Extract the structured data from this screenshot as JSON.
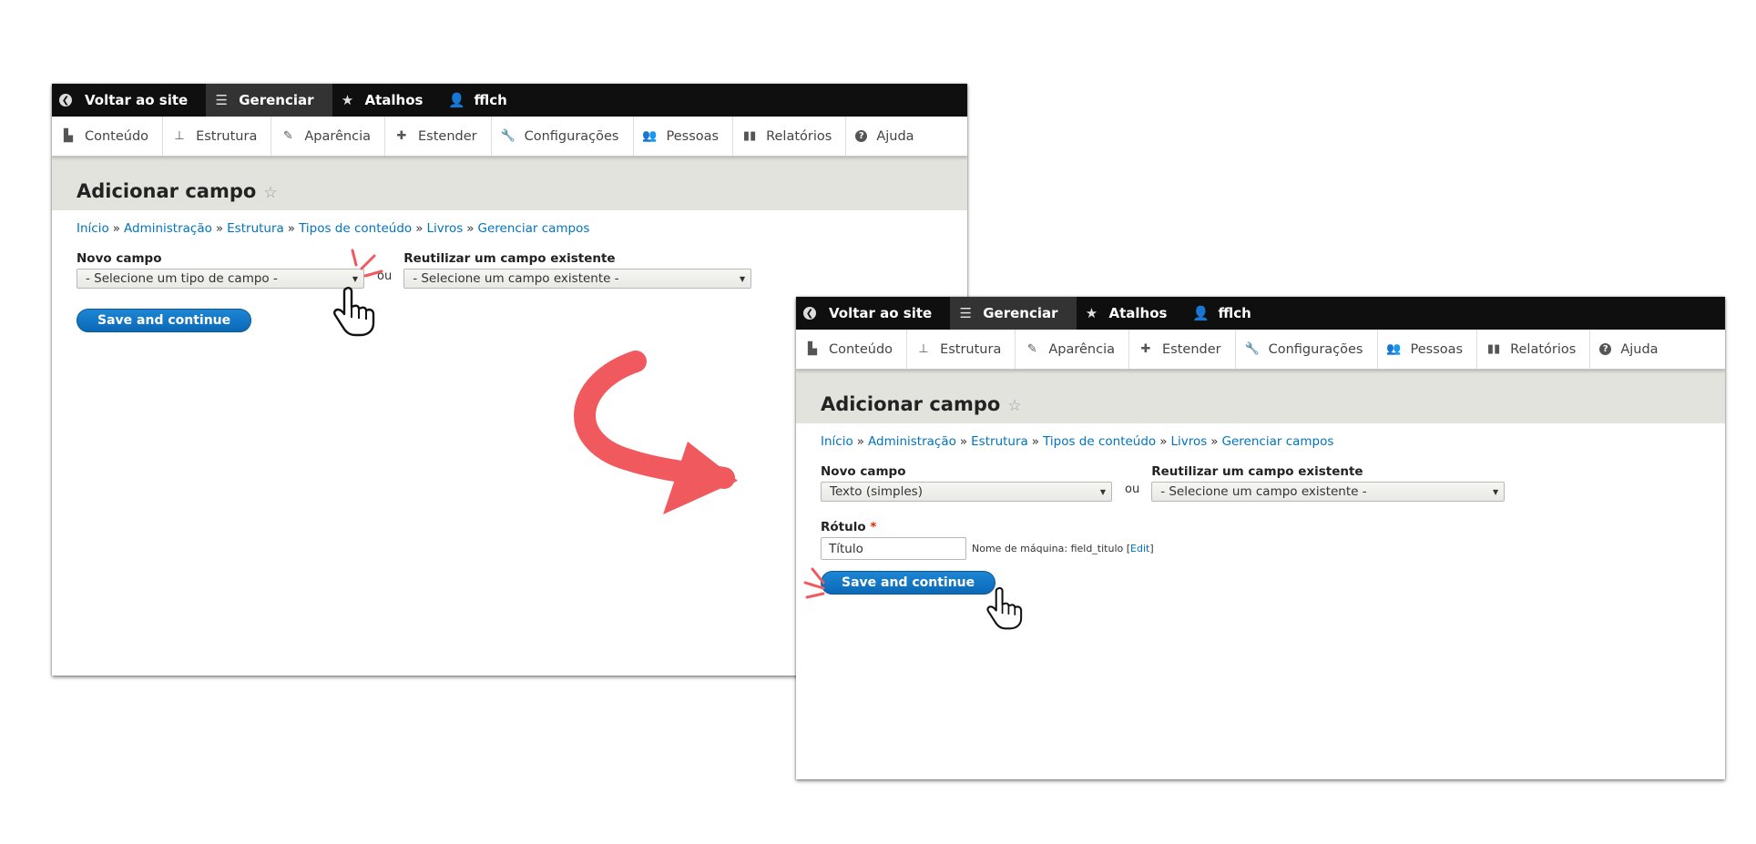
{
  "toolbar": {
    "back": "Voltar ao site",
    "manage": "Gerenciar",
    "shortcuts": "Atalhos",
    "user": "fflch"
  },
  "tray": {
    "content": "Conteúdo",
    "structure": "Estrutura",
    "appearance": "Aparência",
    "extend": "Estender",
    "config": "Configurações",
    "people": "Pessoas",
    "reports": "Relatórios",
    "help": "Ajuda"
  },
  "page": {
    "title": "Adicionar campo",
    "star": "☆"
  },
  "breadcrumb": {
    "home": "Início",
    "admin": "Administração",
    "structure": "Estrutura",
    "content_types": "Tipos de conteúdo",
    "books": "Livros",
    "manage_fields": "Gerenciar campos",
    "sep": "»"
  },
  "form": {
    "new_field_label": "Novo campo",
    "or": "ou",
    "reuse_label": "Reutilizar um campo existente",
    "reuse_value": "- Selecione um campo existente -",
    "save_button": "Save and continue"
  },
  "shot1": {
    "new_field_value": "- Selecione um tipo de campo -"
  },
  "shot2": {
    "new_field_value": "Texto (simples)",
    "label_label": "Rótulo",
    "required_mark": "*",
    "label_value": "Título",
    "machine_name": "Nome de máquina: field_titulo",
    "edit_link": "Edit"
  },
  "icons": {
    "back": "chevron-left-circle-icon",
    "manage": "hamburger-menu-icon",
    "shortcuts": "star-icon",
    "user": "user-icon",
    "content": "file-icon",
    "structure": "sitemap-icon",
    "appearance": "paintbrush-icon",
    "extend": "puzzle-icon",
    "config": "wrench-icon",
    "people": "people-icon",
    "reports": "bar-chart-icon",
    "help": "question-circle-icon",
    "pointer": "hand-pointer-cursor-icon",
    "arrow": "curved-arrow-icon"
  },
  "colors": {
    "toolbar_bg": "#0f0f0f",
    "active_tab": "#333333",
    "header_band": "#e3e3de",
    "link": "#0074bd",
    "button": "#0b69b7",
    "arrow": "#f05a5f"
  }
}
